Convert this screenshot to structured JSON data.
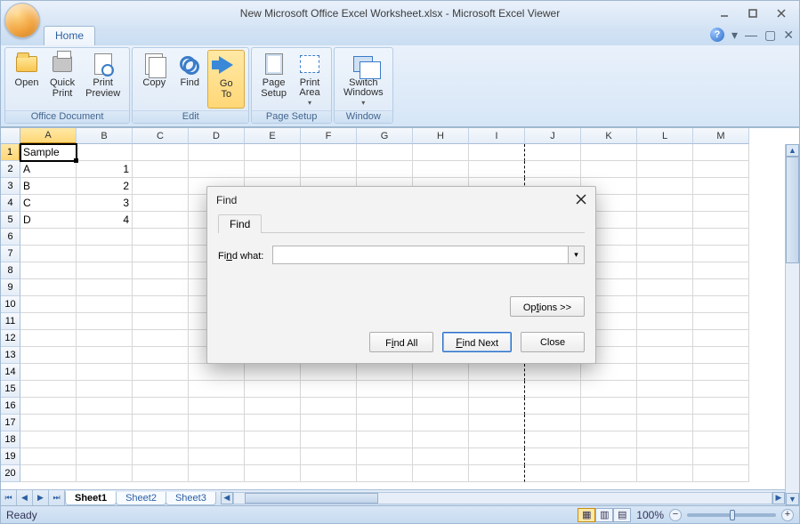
{
  "window": {
    "title": "New Microsoft Office Excel Worksheet.xlsx  -  Microsoft Excel Viewer"
  },
  "tab": {
    "home": "Home"
  },
  "ribbon": {
    "office_document": {
      "label": "Office Document",
      "open": "Open",
      "quick_print": "Quick\nPrint",
      "print_preview": "Print\nPreview"
    },
    "edit": {
      "label": "Edit",
      "copy": "Copy",
      "find": "Find",
      "go_to": "Go\nTo"
    },
    "page_setup": {
      "label": "Page Setup",
      "page_setup": "Page\nSetup",
      "print_area": "Print\nArea"
    },
    "window": {
      "label": "Window",
      "switch_windows": "Switch\nWindows"
    }
  },
  "columns": [
    "A",
    "B",
    "C",
    "D",
    "E",
    "F",
    "G",
    "H",
    "I",
    "J",
    "K",
    "L",
    "M"
  ],
  "rows": 20,
  "selected_cell": {
    "row": 1,
    "col": 0
  },
  "cells": {
    "A1": "Sample",
    "A2": "A",
    "B2": "1",
    "A3": "B",
    "B3": "2",
    "A4": "C",
    "B4": "3",
    "A5": "D",
    "B5": "4"
  },
  "page_break_after_col": 8,
  "sheets": {
    "active": 0,
    "tabs": [
      "Sheet1",
      "Sheet2",
      "Sheet3"
    ]
  },
  "status": {
    "ready": "Ready",
    "zoom": "100%"
  },
  "dialog": {
    "title": "Find",
    "tab": "Find",
    "find_what_label": "Find what:",
    "find_what_value": "",
    "options": "Options >>",
    "find_all": "Find All",
    "find_next": "Find Next",
    "close": "Close"
  }
}
